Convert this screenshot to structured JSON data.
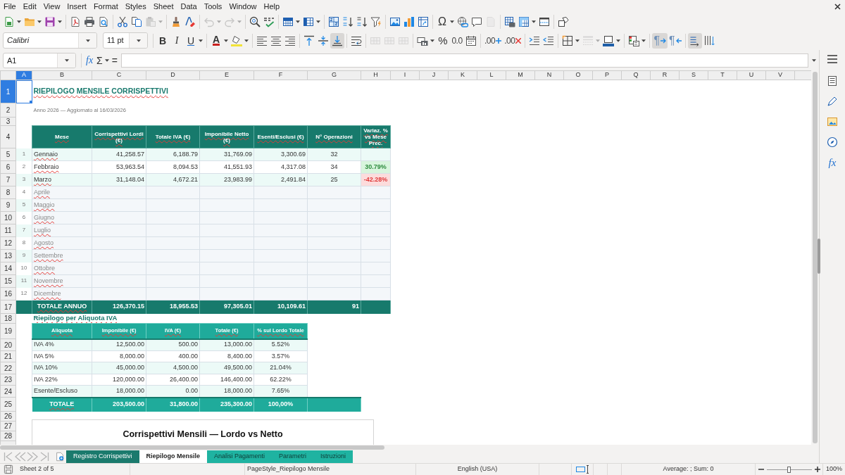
{
  "menu_bar": [
    "File",
    "Edit",
    "View",
    "Insert",
    "Format",
    "Styles",
    "Sheet",
    "Data",
    "Tools",
    "Window",
    "Help"
  ],
  "standard_toolbar": [
    {
      "disabled": false
    },
    {
      "disabled": false
    },
    {
      "disabled": false
    },
    {
      "disabled": false
    },
    {
      "disabled": false
    },
    {
      "disabled": false
    },
    {
      "disabled": false
    },
    {
      "disabled": false
    },
    {
      "disabled": true
    },
    {
      "disabled": false
    },
    {
      "disabled": false
    },
    {
      "disabled": true
    },
    {
      "disabled": true
    },
    {
      "disabled": false
    },
    {
      "disabled": false
    },
    {
      "disabled": false
    },
    {
      "disabled": false
    },
    {
      "disabled": false
    },
    {
      "disabled": false
    },
    {
      "disabled": false
    },
    {
      "disabled": false
    },
    {
      "disabled": false
    },
    {
      "disabled": false
    },
    {
      "disabled": false
    },
    {
      "label": "Ω",
      "disabled": false
    },
    {
      "disabled": false
    },
    {
      "disabled": false
    },
    {
      "disabled": true
    },
    {
      "disabled": false
    },
    {
      "disabled": false
    },
    {
      "disabled": false
    },
    {
      "disabled": false
    }
  ],
  "formatting_toolbar": {
    "font_name": "Calibri",
    "font_size": "11 pt",
    "buttons": [
      {
        "label": "B",
        "on": false,
        "disabled": false
      },
      {
        "label": "I",
        "on": false,
        "disabled": false
      },
      {
        "label": "U",
        "on": false,
        "disabled": false
      },
      {
        "label": "A",
        "on": false,
        "disabled": false
      },
      {
        "on": false,
        "disabled": false
      },
      {
        "on": false,
        "disabled": false
      },
      {
        "on": false,
        "disabled": false
      },
      {
        "on": false,
        "disabled": false
      },
      {
        "on": false,
        "disabled": false
      },
      {
        "on": false,
        "disabled": false
      },
      {
        "on": true,
        "disabled": false
      },
      {
        "on": false,
        "disabled": false
      },
      {
        "on": false,
        "disabled": true
      },
      {
        "on": false,
        "disabled": true
      },
      {
        "on": false,
        "disabled": true
      },
      {
        "on": false,
        "disabled": false
      },
      {
        "label": "%",
        "on": false,
        "disabled": false
      },
      {
        "label": "0.0",
        "on": false,
        "disabled": false
      },
      {
        "on": false,
        "disabled": false
      },
      {
        "label": ".00",
        "on": false,
        "disabled": false
      },
      {
        "label": ".00",
        "on": false,
        "disabled": false
      },
      {
        "on": false,
        "disabled": false
      },
      {
        "on": false,
        "disabled": false
      },
      {
        "on": false,
        "disabled": false
      },
      {
        "on": false,
        "disabled": true
      },
      {
        "on": false,
        "disabled": false
      },
      {
        "on": false,
        "disabled": false
      },
      {
        "label": "¶",
        "on": true,
        "disabled": false
      },
      {
        "label": "¶",
        "on": false,
        "disabled": false
      },
      {
        "on": true,
        "disabled": false
      },
      {
        "on": false,
        "disabled": false
      }
    ]
  },
  "formula_bar": {
    "name_box": "A1",
    "function_wizard": "fx",
    "sum": "Σ",
    "equals": "="
  },
  "sheet": {
    "columns": [
      {
        "label": "A",
        "selected": true
      },
      {
        "label": "B",
        "selected": false
      },
      {
        "label": "C",
        "selected": false
      },
      {
        "label": "D",
        "selected": false
      },
      {
        "label": "E",
        "selected": false
      },
      {
        "label": "F",
        "selected": false
      },
      {
        "label": "G",
        "selected": false
      },
      {
        "label": "H",
        "selected": false
      },
      {
        "label": "I",
        "selected": false
      },
      {
        "label": "J",
        "selected": false
      },
      {
        "label": "K",
        "selected": false
      },
      {
        "label": "L",
        "selected": false
      },
      {
        "label": "M",
        "selected": false
      },
      {
        "label": "N",
        "selected": false
      },
      {
        "label": "O",
        "selected": false
      },
      {
        "label": "P",
        "selected": false
      },
      {
        "label": "Q",
        "selected": false
      },
      {
        "label": "R",
        "selected": false
      },
      {
        "label": "S",
        "selected": false
      },
      {
        "label": "T",
        "selected": false
      },
      {
        "label": "U",
        "selected": false
      },
      {
        "label": "V",
        "selected": false
      }
    ],
    "rows": [
      {
        "label": "1",
        "selected": true
      },
      {
        "label": "2",
        "selected": false
      },
      {
        "label": "3",
        "selected": false
      },
      {
        "label": "4",
        "selected": false
      },
      {
        "label": "5",
        "selected": false
      },
      {
        "label": "6",
        "selected": false
      },
      {
        "label": "7",
        "selected": false
      },
      {
        "label": "8",
        "selected": false
      },
      {
        "label": "9",
        "selected": false
      },
      {
        "label": "10",
        "selected": false
      },
      {
        "label": "11",
        "selected": false
      },
      {
        "label": "12",
        "selected": false
      },
      {
        "label": "13",
        "selected": false
      },
      {
        "label": "14",
        "selected": false
      },
      {
        "label": "15",
        "selected": false
      },
      {
        "label": "16",
        "selected": false
      },
      {
        "label": "17",
        "selected": false
      },
      {
        "label": "18",
        "selected": false
      },
      {
        "label": "19",
        "selected": false
      },
      {
        "label": "20",
        "selected": false
      },
      {
        "label": "21",
        "selected": false
      },
      {
        "label": "22",
        "selected": false
      },
      {
        "label": "23",
        "selected": false
      },
      {
        "label": "24",
        "selected": false
      },
      {
        "label": "25",
        "selected": false
      },
      {
        "label": "26",
        "selected": false
      },
      {
        "label": "27",
        "selected": false
      },
      {
        "label": "28",
        "selected": false
      }
    ],
    "title": "RIEPILOGO MENSILE CORRISPETTIVI",
    "subtitle": "Anno 2026 — Aggiornato al 16/03/2026",
    "monthly_table": {
      "columns": [
        "Mese",
        "Corrispettivi Lordi (€)",
        "Totale IVA (€)",
        "Imponibile Netto (€)",
        "Esenti/Esclusi (€)",
        "N° Operazioni",
        "Variaz. % vs Mese Prec."
      ],
      "rows": [
        {
          "kind": "data",
          "number": "1",
          "month": "Gennaio",
          "gross": "41,258.57",
          "vat": "6,188.79",
          "net": "31,769.09",
          "exempt": "3,300.69",
          "operations": "32"
        },
        {
          "kind": "increase",
          "number": "2",
          "month": "Febbraio",
          "gross": "53,963.54",
          "vat": "8,094.53",
          "net": "41,551.93",
          "exempt": "4,317.08",
          "operations": "34",
          "change": "30.79%"
        },
        {
          "kind": "decrease",
          "number": "3",
          "month": "Marzo",
          "gross": "31,148.04",
          "vat": "4,672.21",
          "net": "23,983.99",
          "exempt": "2,491.84",
          "operations": "25",
          "change": "-42.28%"
        },
        {
          "kind": "empty",
          "number": "4",
          "month": "Aprile"
        },
        {
          "kind": "empty",
          "number": "5",
          "month": "Maggio"
        },
        {
          "kind": "empty",
          "number": "6",
          "month": "Giugno"
        },
        {
          "kind": "empty",
          "number": "7",
          "month": "Luglio"
        },
        {
          "kind": "empty",
          "number": "8",
          "month": "Agosto"
        },
        {
          "kind": "empty",
          "number": "9",
          "month": "Settembre"
        },
        {
          "kind": "empty",
          "number": "10",
          "month": "Ottobre"
        },
        {
          "kind": "empty",
          "number": "11",
          "month": "Novembre"
        },
        {
          "kind": "empty",
          "number": "12",
          "month": "Dicembre"
        }
      ],
      "total": {
        "label": "TOTALE ANNUO",
        "gross": "126,370.15",
        "vat": "18,955.53",
        "net": "97,305.01",
        "exempt": "10,109.61",
        "operations": "91"
      }
    },
    "vat_summary": {
      "title": "Riepilogo per Aliquota IVA",
      "columns": [
        "Aliquota",
        "Imponibile (€)",
        "IVA (€)",
        "Totale (€)",
        "% sul Lordo Totale"
      ],
      "rows": [
        [
          "IVA 4%",
          "12,500.00",
          "500.00",
          "13,000.00",
          "5.52%"
        ],
        [
          "IVA 5%",
          "8,000.00",
          "400.00",
          "8,400.00",
          "3.57%"
        ],
        [
          "IVA 10%",
          "45,000.00",
          "4,500.00",
          "49,500.00",
          "21.04%"
        ],
        [
          "IVA 22%",
          "120,000.00",
          "26,400.00",
          "146,400.00",
          "62.22%"
        ],
        [
          "Esente/Escluso",
          "18,000.00",
          "0.00",
          "18,000.00",
          "7.65%"
        ]
      ],
      "total": [
        "TOTALE",
        "203,500.00",
        "31,800.00",
        "235,300.00",
        "100,00%"
      ]
    },
    "chart": {
      "title": "Corrispettivi Mensili — Lordo vs Netto"
    }
  },
  "sidebar": {
    "functions": "fx"
  },
  "sheet_tabs": [
    {
      "label": "Registro Corrispettivi",
      "selected": false,
      "color": "#1b7a6d"
    },
    {
      "label": "Riepilogo Mensile",
      "selected": true
    },
    {
      "label": "Analisi Pagamenti",
      "selected": false,
      "color": "#1fb3a1"
    },
    {
      "label": "Parametri",
      "selected": false,
      "color": "#1fb3a1"
    },
    {
      "label": "Istruzioni",
      "selected": false,
      "color": "#1fb3a1"
    }
  ],
  "status_bar": {
    "sheet_position": "Sheet 2 of 5",
    "page_style": "PageStyle_Riepilogo Mensile",
    "language": "English (USA)",
    "statistics": "Average: ; Sum: 0",
    "zoom": {
      "level": 0.5,
      "reading": "100%"
    }
  }
}
